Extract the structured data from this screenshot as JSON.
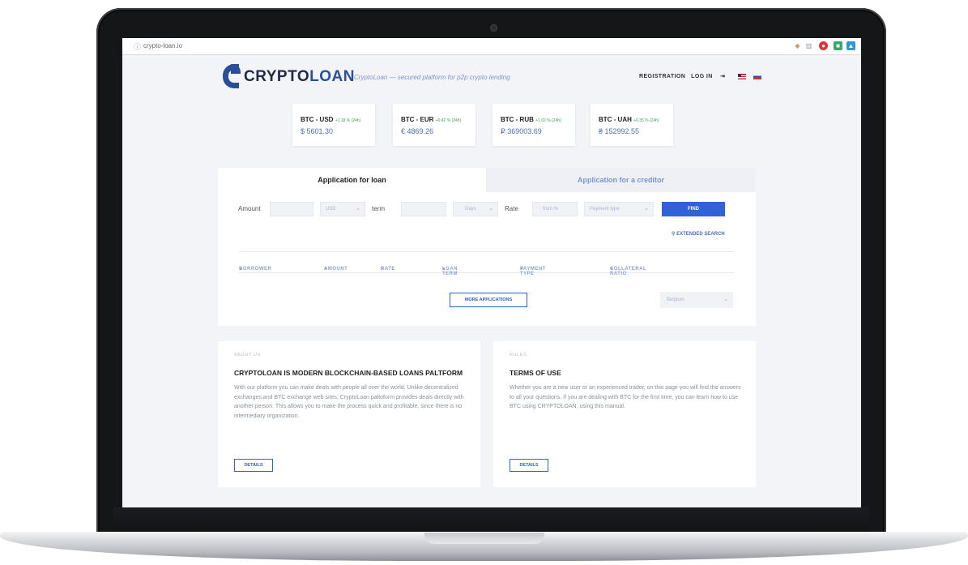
{
  "browser": {
    "url": "crypto-loan.io"
  },
  "header": {
    "logo_main": "CRYPTO",
    "logo_accent": "LOAN",
    "tagline": "CryptoLoan — secured platform for p2p crypto lending",
    "registration": "REGISTRATION",
    "login": "LOG IN",
    "login_icon": "login-icon"
  },
  "rates": [
    {
      "pair": "BTC - USD",
      "change": "+1.18 % (24h)",
      "value": "$ 5601.30"
    },
    {
      "pair": "BTC - EUR",
      "change": "+0.42 % (24h)",
      "value": "€ 4869.26"
    },
    {
      "pair": "BTC - RUB",
      "change": "+1.02 % (24h)",
      "value": "₽ 369003.69"
    },
    {
      "pair": "BTC - UAH",
      "change": "+0.35 % (24h)",
      "value": "₴ 152992.55"
    }
  ],
  "tabs": {
    "loan": "Application for loan",
    "creditor": "Application for a creditor"
  },
  "filters": {
    "amount_label": "Amount",
    "currency": "USD",
    "term_label": "term",
    "days": "Days",
    "rate_label": "Rate",
    "rate_placeholder": "from %",
    "payment_type": "Payment type",
    "find": "FIND",
    "extended_search": "EXTENDED SEARCH"
  },
  "columns": [
    "BORROWER",
    "AMOUNT",
    "RATE",
    "LOAN TERM",
    "PAYMENT TYPE",
    "COLLATERAL RATIO"
  ],
  "more_applications": "MORE APPLICATIONS",
  "country": "Belgium",
  "about": {
    "kicker": "ABOUT US",
    "title": "CRYPTOLOAN IS MODERN BLOCKCHAIN-BASED LOANS PALTFORM",
    "body": "With our platform you can make deals with people all over the world. Unlike decentralized exchanges and BTC exchange web sites, CryptoLoan paltoform provides deals directly with another person. This allows you to make the process quick and profitable, since there is no intermediary organization.",
    "button": "DETAILS"
  },
  "rules": {
    "kicker": "RULES",
    "title": "TERMS OF USE",
    "body": "Whether you are a new user or an experienced trader, on this page you will find the answers to all your questions. If you are dealing with BTC for the first time, you can learn how to use BTC using CRYPTOLOAN, using this manual.",
    "button": "DETAILS"
  },
  "colors": {
    "brand": "#2a4f9a",
    "accent": "#2e62d6",
    "positive": "#3aa655"
  }
}
